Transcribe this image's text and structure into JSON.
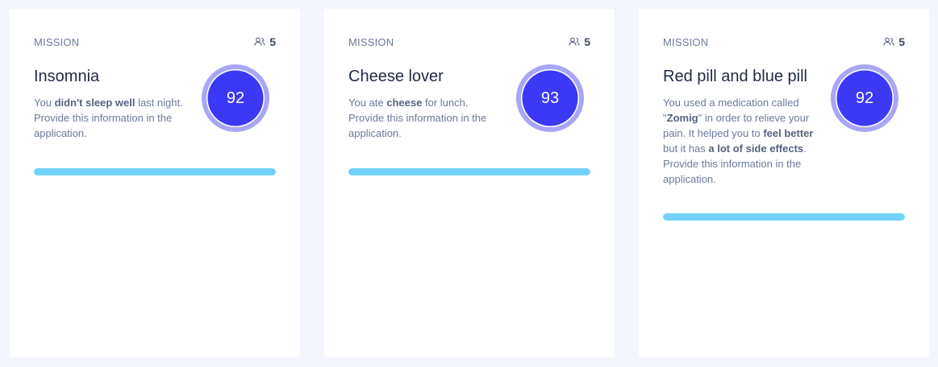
{
  "cards": [
    {
      "label": "MISSION",
      "participants": "5",
      "title": "Insomnia",
      "description": [
        {
          "text": "You ",
          "bold": false
        },
        {
          "text": "didn't sleep well",
          "bold": true
        },
        {
          "text": " last night. Provide this information in the application.",
          "bold": false
        }
      ],
      "score": "92",
      "progress_percent": 100
    },
    {
      "label": "MISSION",
      "participants": "5",
      "title": "Cheese lover",
      "description": [
        {
          "text": "You ate ",
          "bold": false
        },
        {
          "text": "cheese",
          "bold": true
        },
        {
          "text": " for lunch. Provide this information in the application.",
          "bold": false
        }
      ],
      "score": "93",
      "progress_percent": 100
    },
    {
      "label": "MISSION",
      "participants": "5",
      "title": "Red pill and blue pill",
      "description": [
        {
          "text": "You used a medication called \"",
          "bold": false
        },
        {
          "text": "Zomig",
          "bold": true
        },
        {
          "text": "\" in order to relieve your pain. It helped you to ",
          "bold": false
        },
        {
          "text": "feel better",
          "bold": true
        },
        {
          "text": " but it has ",
          "bold": false
        },
        {
          "text": "a lot of side effects",
          "bold": true
        },
        {
          "text": ". Provide this information in the application.",
          "bold": false
        }
      ],
      "score": "92",
      "progress_percent": 100
    }
  ],
  "icons": {
    "participants": "users-icon"
  },
  "colors": {
    "score_fill": "#3b39f5",
    "score_ring": "#a9a6f6",
    "progress_fill": "#72d1fb",
    "title": "#1f2a44",
    "muted": "#6b7a99"
  }
}
